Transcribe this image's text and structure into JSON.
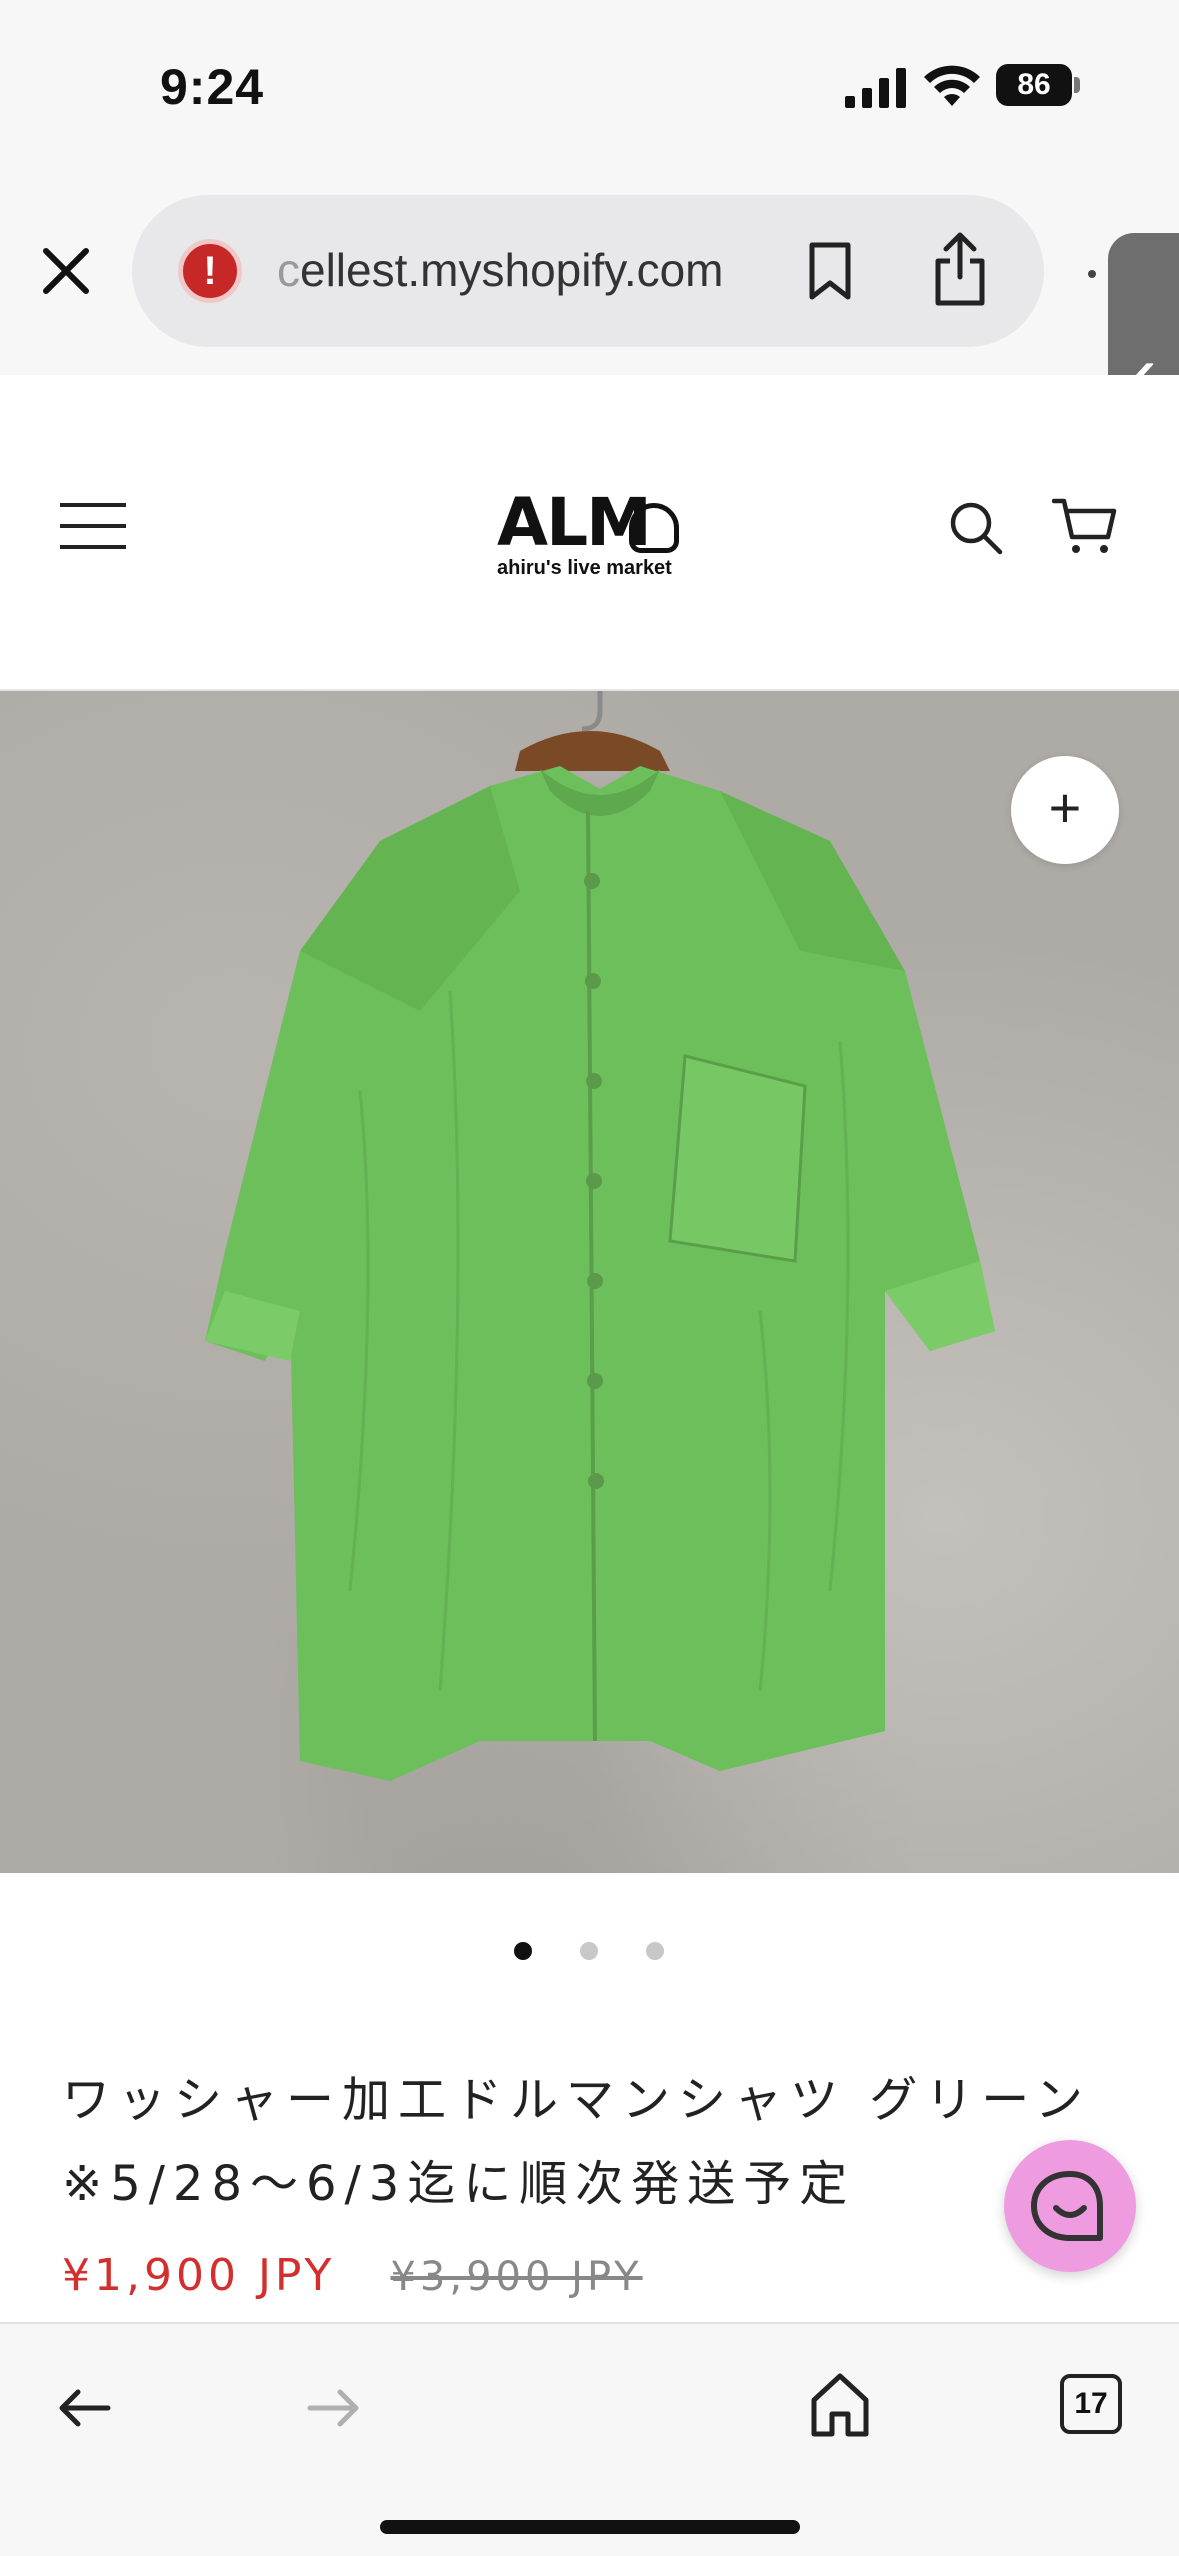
{
  "status_bar": {
    "time": "9:24",
    "battery": "86"
  },
  "browser": {
    "url_visible": "cellest.myshopify.com",
    "url_faded_prefix": "c",
    "url_rest": "ellest.myshopify.com",
    "tab_count": "17"
  },
  "site": {
    "logo_text": "ALM",
    "logo_tagline": "ahiru's live market"
  },
  "product": {
    "title": "ワッシャー加工ドルマンシャツ グリーン ※5/28～6/3迄に順次発送予定",
    "price_sale": "¥1,900 JPY",
    "price_original": "¥3,900 JPY",
    "zoom_label": "+",
    "image_count": 3,
    "active_image_index": 0
  },
  "colors": {
    "sale_price": "#d32f2f",
    "shirt_green": "#6cbf5a",
    "chat_button": "#ee9be0",
    "warning_icon": "#c62828"
  },
  "icons": {
    "close": "close-icon",
    "site_warning": "warning-icon",
    "bookmark": "bookmark-icon",
    "share": "share-icon",
    "menu": "hamburger-icon",
    "search": "search-icon",
    "cart": "cart-icon",
    "chat": "chat-icon",
    "back": "arrow-left-icon",
    "forward": "arrow-right-icon",
    "home": "home-icon"
  }
}
